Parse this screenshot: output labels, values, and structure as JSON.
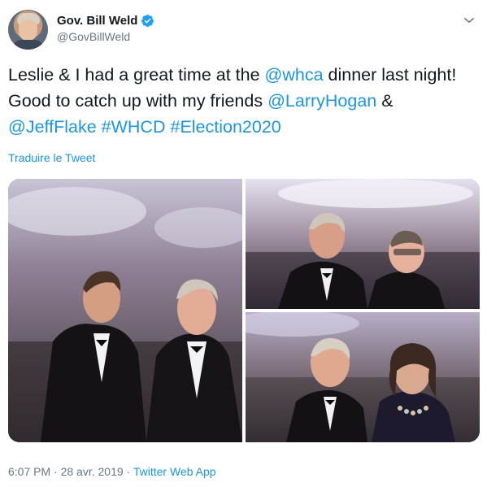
{
  "author": {
    "display_name": "Gov. Bill Weld",
    "handle": "@GovBillWeld",
    "avatar_icon": "profile-avatar",
    "verified_icon": "verified-badge-icon",
    "menu_icon": "chevron-down-icon"
  },
  "tweet": {
    "parts": [
      {
        "text": "Leslie & I had a great time at the ",
        "link": false
      },
      {
        "text": "@whca",
        "link": true
      },
      {
        "text": " dinner last night! Good to catch up with my friends ",
        "link": false
      },
      {
        "text": "@LarryHogan",
        "link": true
      },
      {
        "text": " & ",
        "link": false
      },
      {
        "text": "@JeffFlake",
        "link": true
      },
      {
        "text": " ",
        "link": false
      },
      {
        "text": "#WHCD",
        "link": true
      },
      {
        "text": " ",
        "link": false
      },
      {
        "text": "#Election2020",
        "link": true
      }
    ],
    "translate_label": "Traduire le Tweet"
  },
  "media": {
    "count": 3
  },
  "meta": {
    "timestamp": "6:07 PM · 28 avr. 2019",
    "separator": " · ",
    "source": "Twitter Web App"
  },
  "colors": {
    "link": "#1b95e0",
    "text": "#14171a",
    "secondary": "#657786"
  }
}
